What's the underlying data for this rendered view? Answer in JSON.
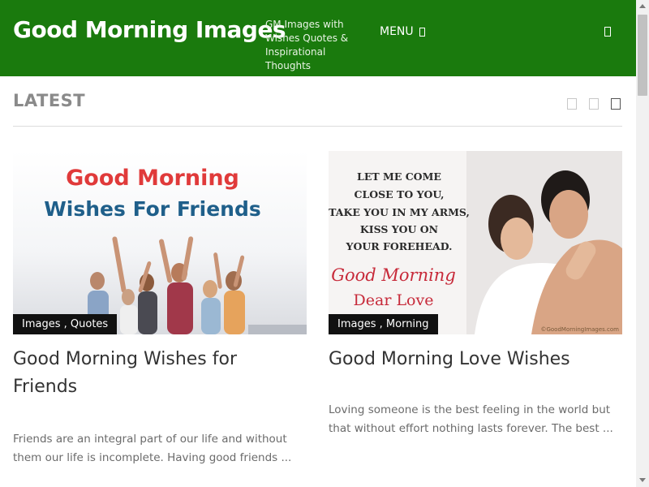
{
  "header": {
    "site_title": "Good Morning Images",
    "tagline": "GM Images with Wishes Quotes & Inspirational Thoughts",
    "menu_label": "MENU",
    "bg_color": "#1a7a0d"
  },
  "section": {
    "heading": "LATEST"
  },
  "posts": [
    {
      "title": "Good Morning Wishes for Friends",
      "categories": [
        "Images",
        "Quotes"
      ],
      "category_separator": " , ",
      "image_text": [
        "Good Morning",
        "Wishes For Friends"
      ],
      "excerpt": "Friends are an integral part of our life and without them our life is incomplete. Having good friends ..."
    },
    {
      "title": "Good Morning Love Wishes",
      "categories": [
        "Images",
        "Morning"
      ],
      "category_separator": " , ",
      "image_text": [
        "LET ME COME",
        "CLOSE TO YOU,",
        "TAKE YOU IN MY ARMS,",
        "KISS YOU ON",
        "YOUR FOREHEAD.",
        "Good Morning",
        "Dear Love",
        "©GoodMorningImages.com"
      ],
      "excerpt": "Loving someone is the best feeling in the world but that without effort nothing lasts forever. The best ..."
    }
  ]
}
